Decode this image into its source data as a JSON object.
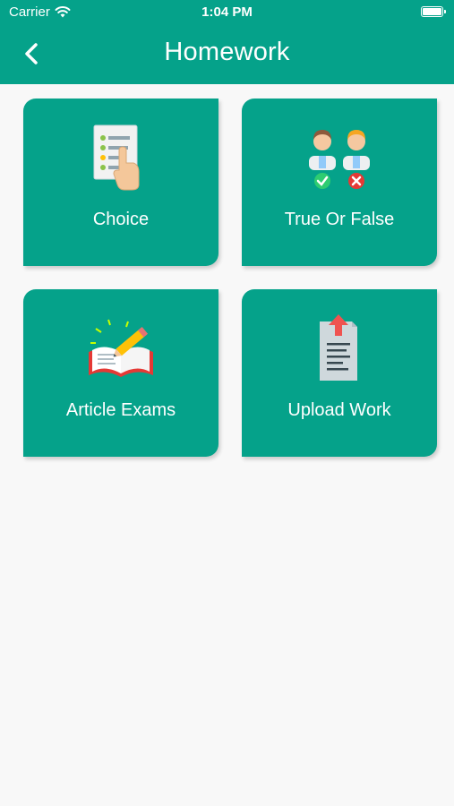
{
  "status_bar": {
    "carrier": "Carrier",
    "time": "1:04 PM"
  },
  "header": {
    "title": "Homework"
  },
  "cards": [
    {
      "label": "Choice",
      "icon": "checklist-hand-icon"
    },
    {
      "label": "True Or False",
      "icon": "true-false-people-icon"
    },
    {
      "label": "Article Exams",
      "icon": "book-pencil-icon"
    },
    {
      "label": "Upload Work",
      "icon": "document-upload-icon"
    }
  ],
  "colors": {
    "primary": "#05a28a",
    "background": "#f8f8f8"
  }
}
